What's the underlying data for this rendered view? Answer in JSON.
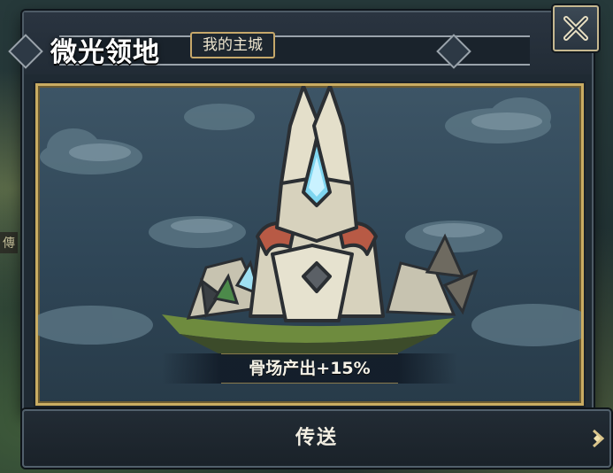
{
  "header": {
    "title": "微光领地",
    "tag": "我的主城"
  },
  "close_button": {
    "icon": "close-icon"
  },
  "art": {
    "subject": "bone-fortress-illustration",
    "bonus_text": "骨场产出+15%"
  },
  "actions": {
    "teleport_label": "传送",
    "arrow_icon": "arrow-right-icon"
  },
  "backdrop": {
    "side_label": "傳"
  },
  "colors": {
    "panel": "#1f2a33",
    "gold_frame": "#c9ac62",
    "sky": "#3d5566",
    "crystal": "#7fd6f0"
  }
}
